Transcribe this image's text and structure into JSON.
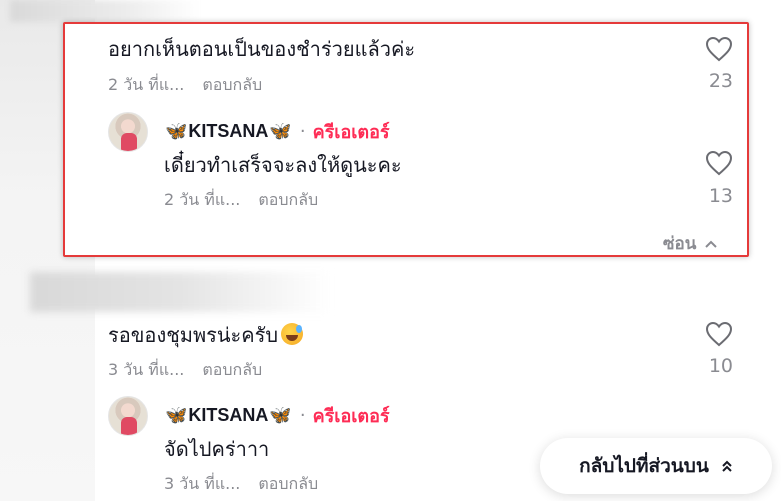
{
  "comments": [
    {
      "text": "อยากเห็นตอนเป็นของชำร่วยแล้วค่ะ",
      "time": "2 วัน ที่แ...",
      "reply_label": "ตอบกลับ",
      "likes": "23",
      "reply": {
        "author": "KITSANA",
        "badge": "ครีเอเตอร์",
        "text": "เดี๋ยวทำเสร็จจะลงให้ดูนะคะ",
        "time": "2 วัน ที่แ...",
        "reply_label": "ตอบกลับ",
        "likes": "13"
      },
      "hide_label": "ซ่อน"
    },
    {
      "text": "รอของชุมพรน่ะครับ",
      "time": "3 วัน ที่แ...",
      "reply_label": "ตอบกลับ",
      "likes": "10",
      "reply": {
        "author": "KITSANA",
        "badge": "ครีเอเตอร์",
        "text": "จัดไปคร่าาา",
        "time": "3 วัน ที่แ...",
        "reply_label": "ตอบกลับ"
      }
    }
  ],
  "back_to_top_label": "กลับไปที่ส่วนบน",
  "colors": {
    "creator_accent": "#fe2c55",
    "highlight_border": "#e53a3a",
    "muted": "#8a8b91"
  },
  "icons": [
    "heart-icon",
    "butterfly-icon",
    "chevron-up-icon",
    "double-chevron-up-icon",
    "emoji-icon"
  ]
}
